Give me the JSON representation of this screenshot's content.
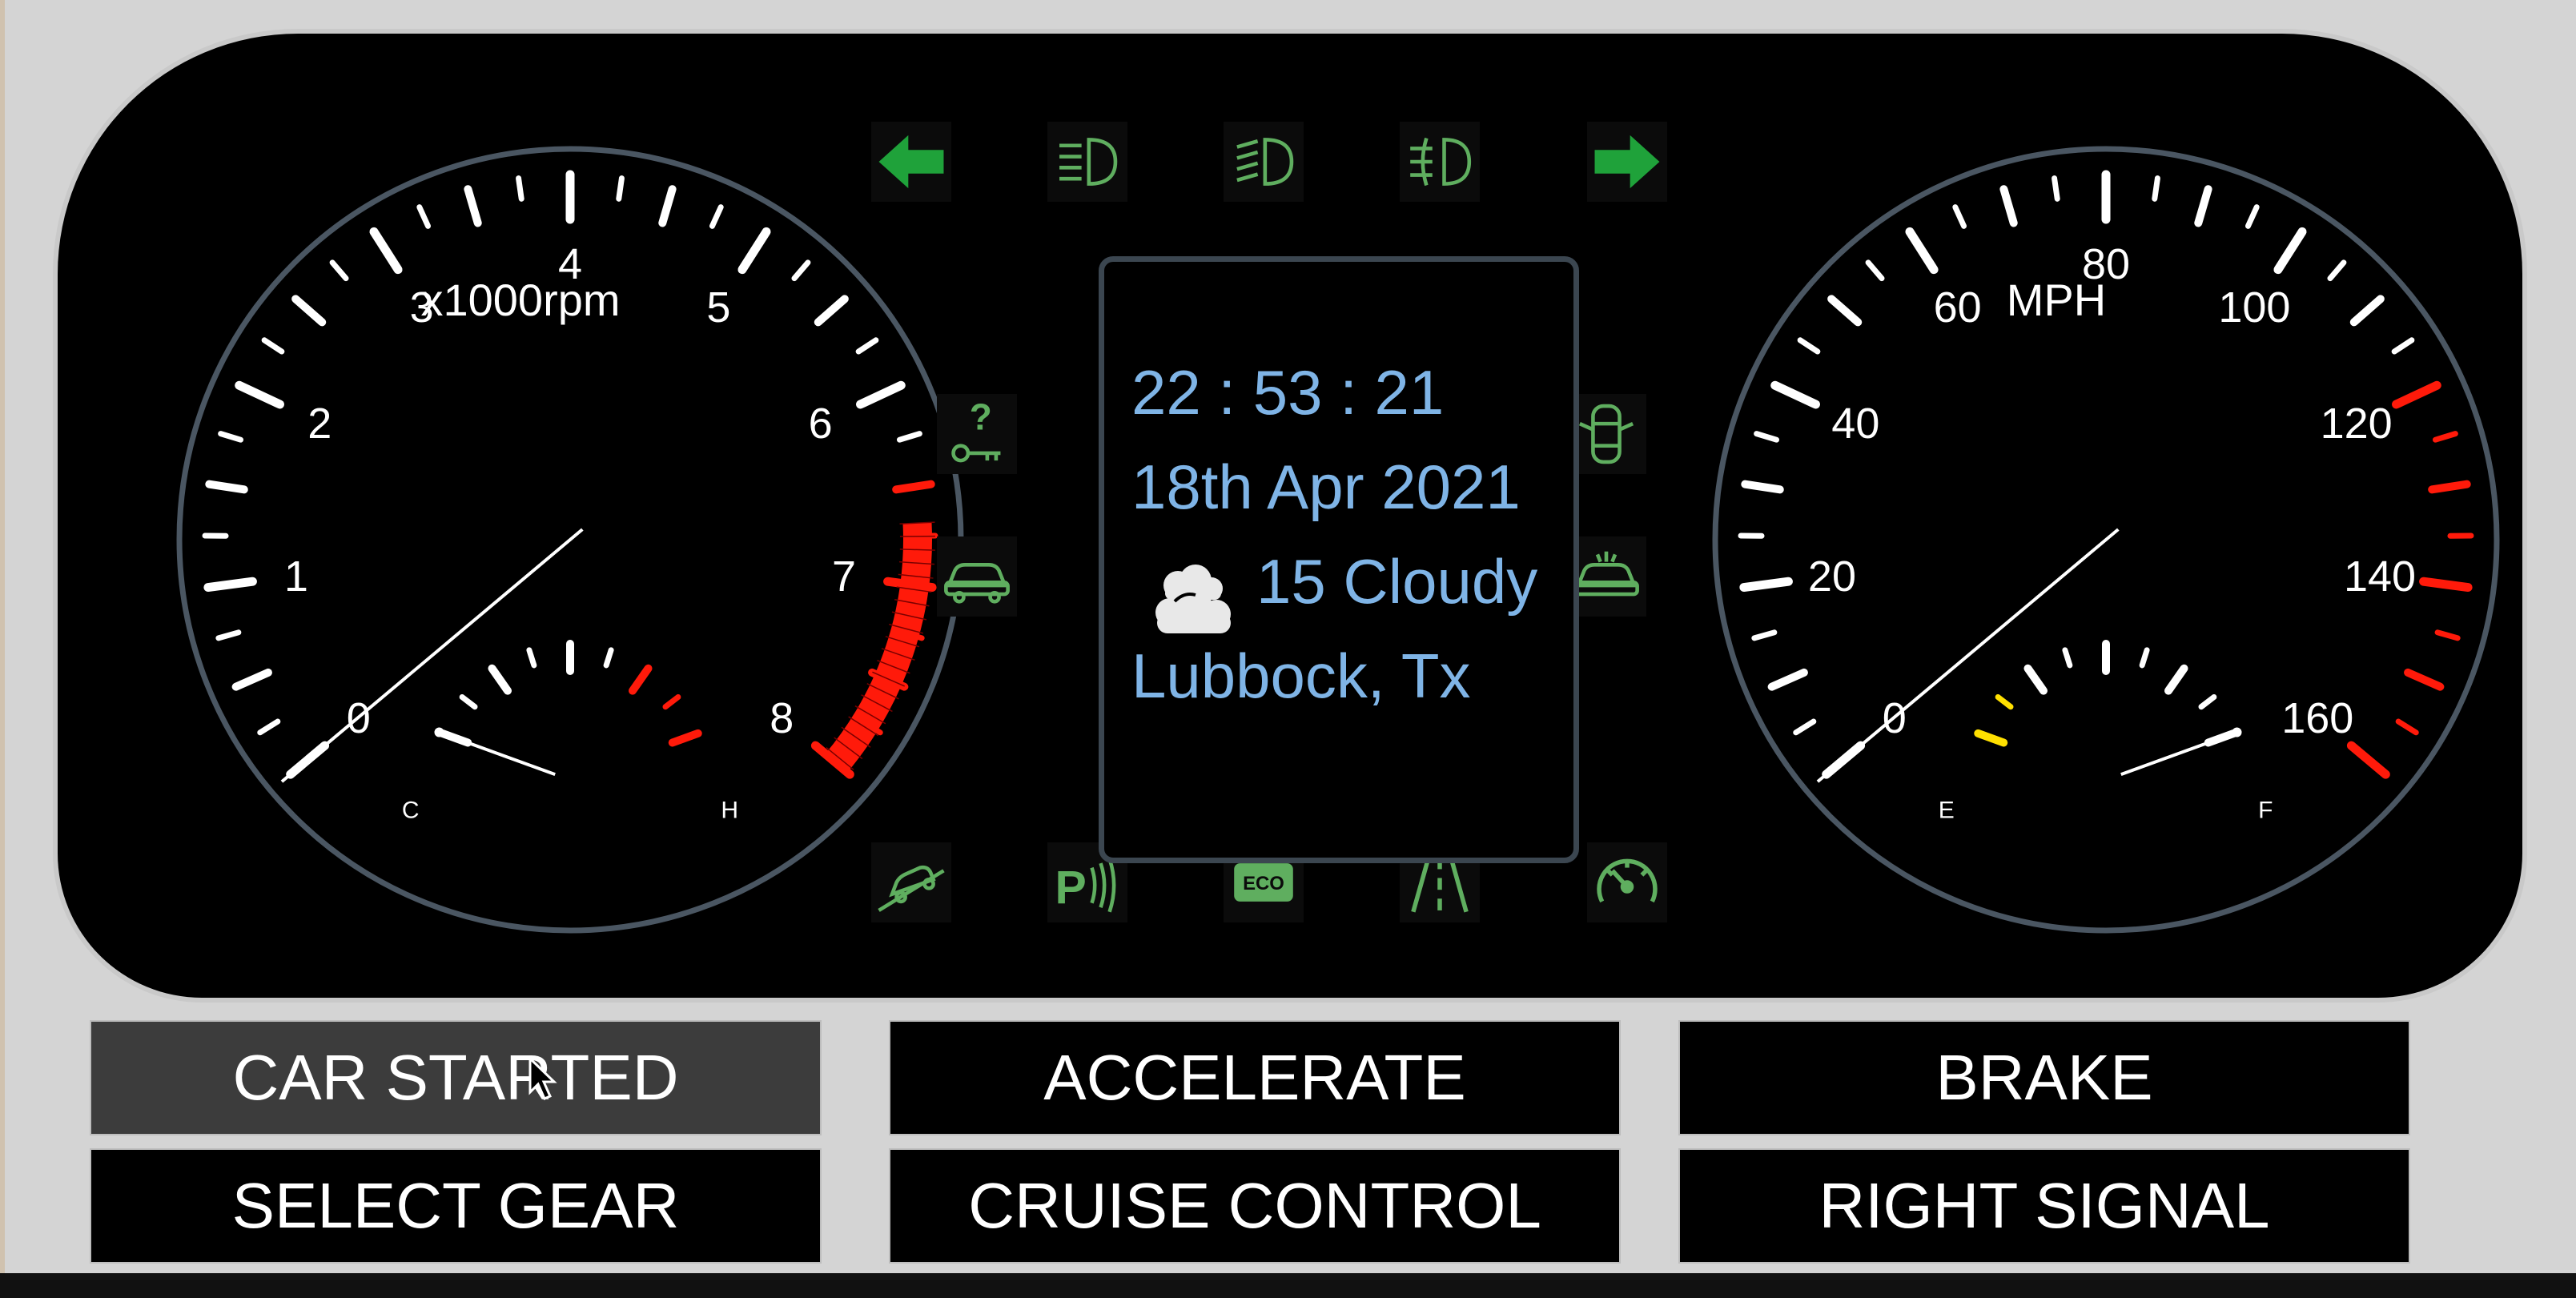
{
  "tachometer": {
    "unit_label": "x1000rpm",
    "tick_labels": [
      "0",
      "1",
      "2",
      "3",
      "4",
      "5",
      "6",
      "7",
      "8"
    ],
    "value_rpm_x1000": 0,
    "redline_from": 6.5
  },
  "temperature": {
    "low_label": "C",
    "high_label": "H",
    "value_fraction": 0.0
  },
  "speedometer": {
    "unit_label": "MPH",
    "tick_labels": [
      "0",
      "20",
      "40",
      "60",
      "80",
      "100",
      "120",
      "140",
      "160"
    ],
    "value_mph": 0,
    "red_from": 120
  },
  "fuel": {
    "low_label": "E",
    "high_label": "F",
    "value_fraction": 1.0
  },
  "info_panel": {
    "time": "22 : 53 : 21",
    "date": "18th Apr 2021",
    "weather": "15 Cloudy",
    "weather_icon": "cloud-icon",
    "location": "Lubbock, Tx"
  },
  "indicators": {
    "top": [
      "left-arrow-icon",
      "low-beam-icon",
      "high-beam-icon",
      "fog-light-icon",
      "right-arrow-icon"
    ],
    "left": [
      "key-warning-icon",
      "car-icon"
    ],
    "right": [
      "door-open-icon",
      "car-alert-icon"
    ],
    "bottom": [
      "hill-descent-icon",
      "parking-sensor-icon",
      "eco-icon",
      "lane-assist-icon",
      "cruise-speed-icon"
    ]
  },
  "controls": {
    "car_started": "CAR STARTED",
    "accelerate": "ACCELERATE",
    "brake": "BRAKE",
    "select_gear": "SELECT GEAR",
    "cruise_control": "CRUISE CONTROL",
    "right_signal": "RIGHT SIGNAL"
  },
  "colors": {
    "indicator_active": "#1fa23a",
    "indicator_dim": "#5fae5f",
    "info_text": "#7fb4e6",
    "redline": "#ff1a0a",
    "fuel_low": "#ffe000"
  }
}
